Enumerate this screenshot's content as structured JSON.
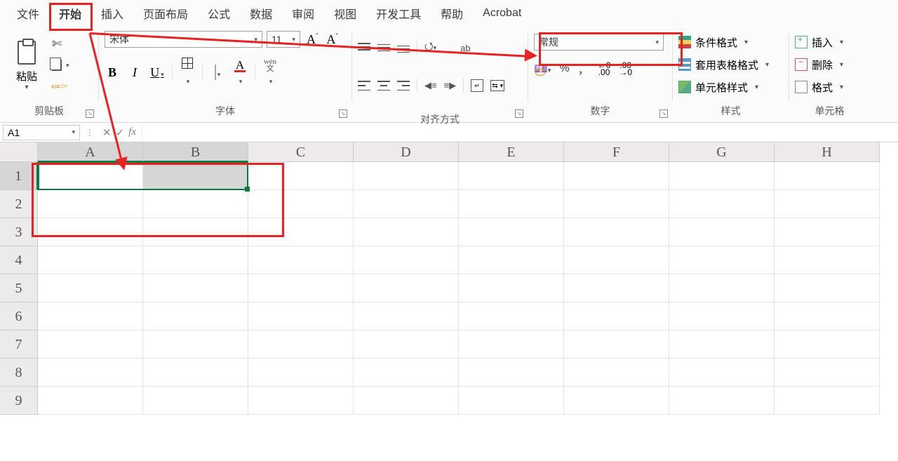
{
  "tabs": {
    "file": "文件",
    "home": "开始",
    "insert": "插入",
    "layout": "页面布局",
    "formulas": "公式",
    "data": "数据",
    "review": "审阅",
    "view": "视图",
    "dev": "开发工具",
    "help": "帮助",
    "acrobat": "Acrobat"
  },
  "clipboard": {
    "paste": "粘贴",
    "group": "剪贴板"
  },
  "font": {
    "name": "宋体",
    "size": "11",
    "pinyin_top": "wén",
    "pinyin_bottom": "文",
    "group": "字体"
  },
  "align": {
    "wrap_ab": "ab",
    "group": "对齐方式"
  },
  "number": {
    "format": "常规",
    "percent": "%",
    "comma": "，",
    "dec_inc_top": "←0",
    "dec_inc_bot": ".00",
    "dec_dec_top": ".00",
    "dec_dec_bot": "→0",
    "group": "数字"
  },
  "styles": {
    "cond": "条件格式",
    "table": "套用表格格式",
    "cell": "单元格样式",
    "group": "样式"
  },
  "cells": {
    "insert": "插入",
    "delete": "删除",
    "format": "格式",
    "group": "单元格"
  },
  "fbar": {
    "name": "A1",
    "fx": "fx"
  },
  "cols": [
    "A",
    "B",
    "C",
    "D",
    "E",
    "F",
    "G",
    "H"
  ],
  "rows": [
    "1",
    "2",
    "3",
    "4",
    "5",
    "6",
    "7",
    "8",
    "9"
  ]
}
